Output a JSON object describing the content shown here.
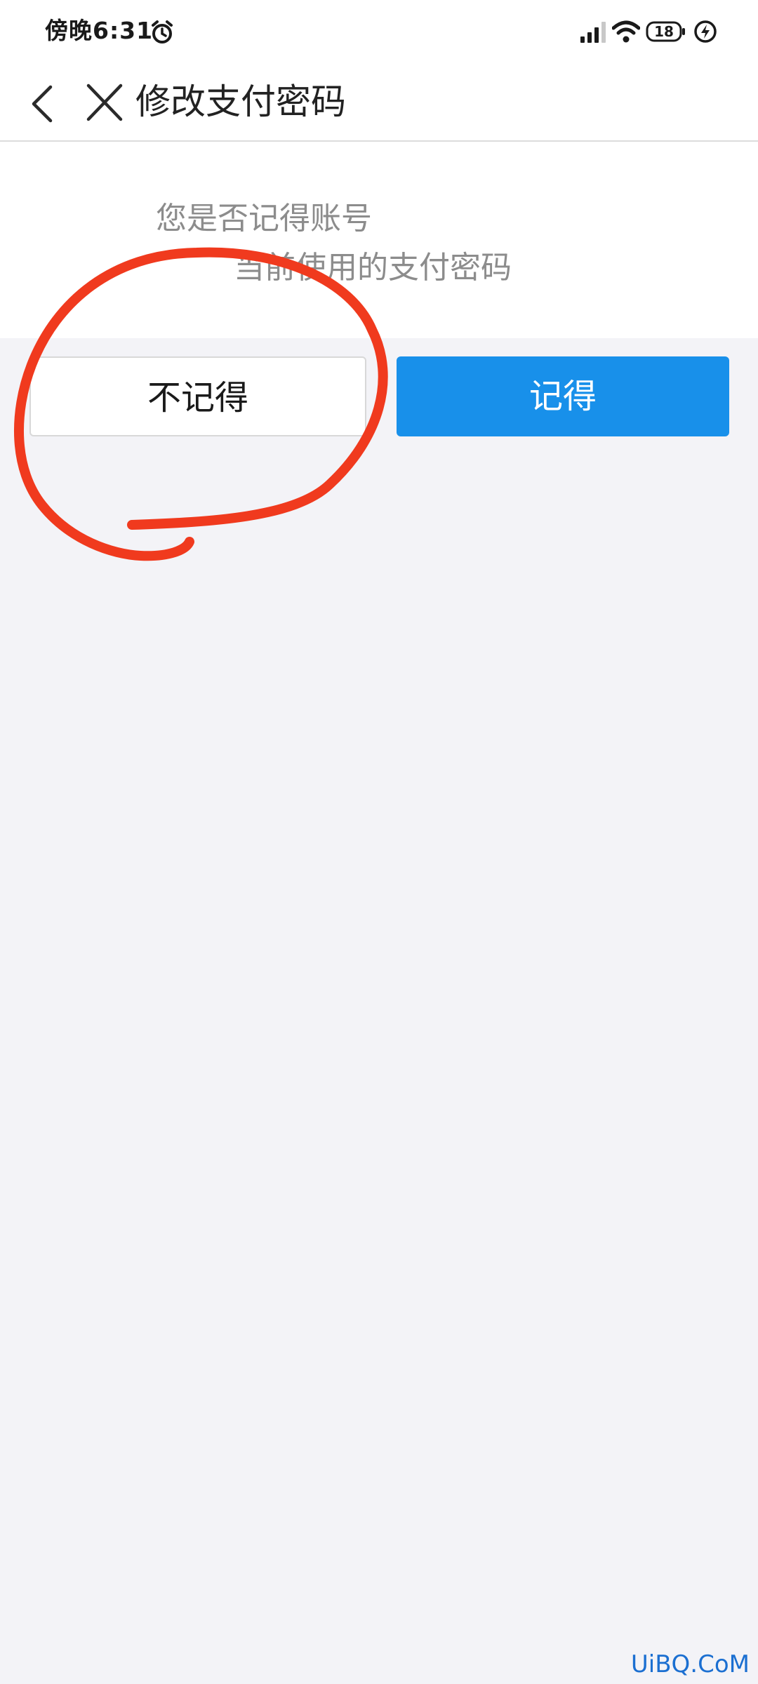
{
  "status_bar": {
    "time": "傍晚6:31",
    "battery": "18",
    "icons": [
      "alarm-icon",
      "signal-icon",
      "wifi-icon",
      "battery-icon",
      "charging-icon"
    ]
  },
  "nav": {
    "title": "修改支付密码",
    "icons": [
      "back-arrow-icon",
      "close-icon"
    ]
  },
  "question": {
    "line1": "您是否记得账号",
    "line2": "当前使用的支付密码"
  },
  "buttons": {
    "forgot": "不记得",
    "remember": "记得"
  },
  "watermark": "UiBQ.CoM",
  "colors": {
    "primary": "#1890ea",
    "annotation": "#f03a1e",
    "background": "#f3f3f7"
  }
}
